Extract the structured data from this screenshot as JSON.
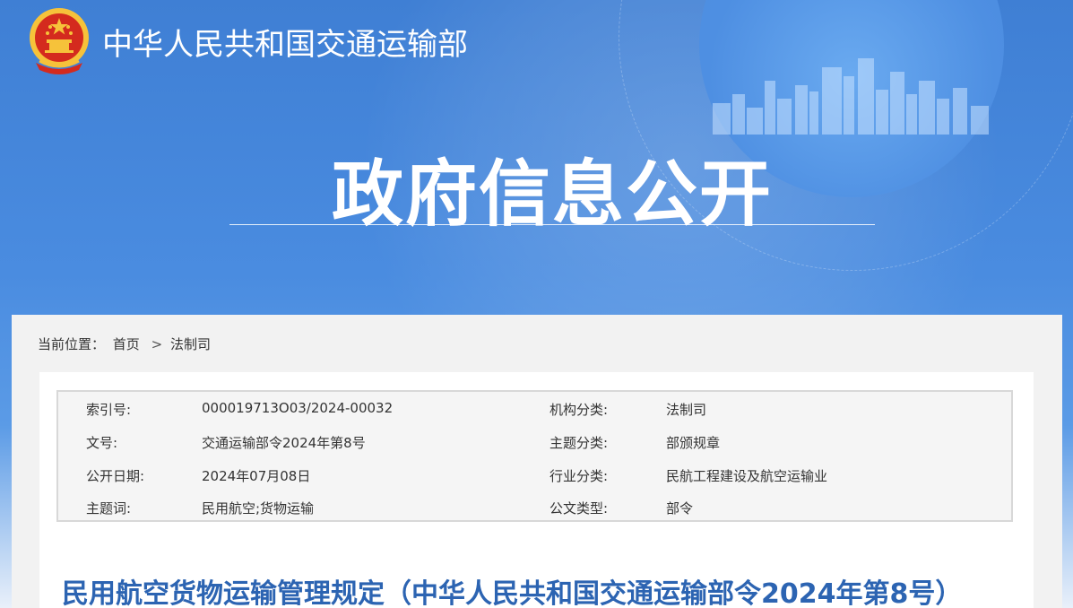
{
  "header": {
    "ministry_name": "中华人民共和国交通运输部",
    "section_title": "政府信息公开"
  },
  "breadcrumb": {
    "label": "当前位置：",
    "items": [
      "首页",
      "法制司"
    ],
    "separator": ">"
  },
  "meta": {
    "rows": [
      {
        "k1": "索引号:",
        "v1": "000019713O03/2024-00032",
        "k2": "机构分类:",
        "v2": "法制司"
      },
      {
        "k1": "文号:",
        "v1": "交通运输部令2024年第8号",
        "k2": "主题分类:",
        "v2": "部颁规章"
      },
      {
        "k1": "公开日期:",
        "v1": "2024年07月08日",
        "k2": "行业分类:",
        "v2": "民航工程建设及航空运输业"
      },
      {
        "k1": "主题词:",
        "v1": "民用航空;货物运输",
        "k2": "公文类型:",
        "v2": "部令"
      }
    ]
  },
  "document": {
    "title": "民用航空货物运输管理规定（中华人民共和国交通运输部令2024年第8号）"
  },
  "colors": {
    "banner_blue": "#3f7fd4",
    "title_blue": "#2c64b2",
    "emblem_red": "#d42a1e",
    "emblem_gold": "#f6c23a"
  },
  "icons": {
    "emblem": "national-emblem-icon"
  }
}
